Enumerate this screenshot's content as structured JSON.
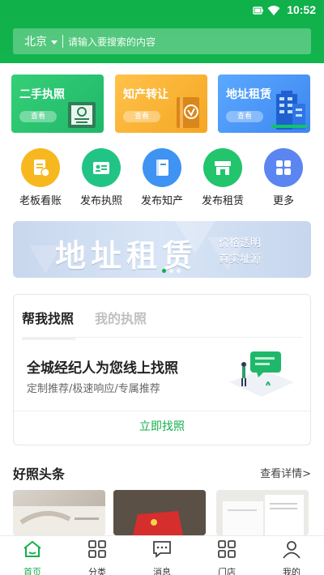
{
  "status_bar": {
    "time": "10:52"
  },
  "search": {
    "city": "北京",
    "placeholder": "请输入要搜索的内容"
  },
  "quick_cards": [
    {
      "title": "二手执照",
      "button": "查看",
      "icon": "license-certificate-icon"
    },
    {
      "title": "知产转让",
      "button": "查看",
      "icon": "trademark-book-icon"
    },
    {
      "title": "地址租赁",
      "button": "查看",
      "icon": "building-icon"
    }
  ],
  "services": [
    {
      "label": "老板看账",
      "icon": "ledger-icon",
      "color": "#f7b81f"
    },
    {
      "label": "发布执照",
      "icon": "license-card-icon",
      "color": "#22c486"
    },
    {
      "label": "发布知产",
      "icon": "book-icon",
      "color": "#3f93f2"
    },
    {
      "label": "发布租赁",
      "icon": "storefront-icon",
      "color": "#22c46c"
    },
    {
      "label": "更多",
      "icon": "grid-more-icon",
      "color": "#5b86f1"
    }
  ],
  "banner": {
    "title": "地址租赁",
    "subtitle_1": "价格透明",
    "subtitle_2": "真实址源",
    "slides": 3,
    "active_slide": 1
  },
  "find_license": {
    "tabs": [
      "帮我找照",
      "我的执照"
    ],
    "active_tab": 0,
    "headline": "全城经纪人为您线上找照",
    "subline": "定制推荐/极速响应/专属推荐",
    "button": "立即找照"
  },
  "news": {
    "title": "好照头条",
    "more": "查看详情>"
  },
  "tabbar": [
    {
      "label": "首页",
      "icon": "home-icon",
      "active": true
    },
    {
      "label": "分类",
      "icon": "category-icon",
      "active": false
    },
    {
      "label": "消息",
      "icon": "message-icon",
      "active": false
    },
    {
      "label": "门店",
      "icon": "store-icon",
      "active": false
    },
    {
      "label": "我的",
      "icon": "profile-icon",
      "active": false
    }
  ],
  "colors": {
    "brand_green": "#10b04a",
    "text_dark": "#222222",
    "text_muted": "#666666"
  }
}
